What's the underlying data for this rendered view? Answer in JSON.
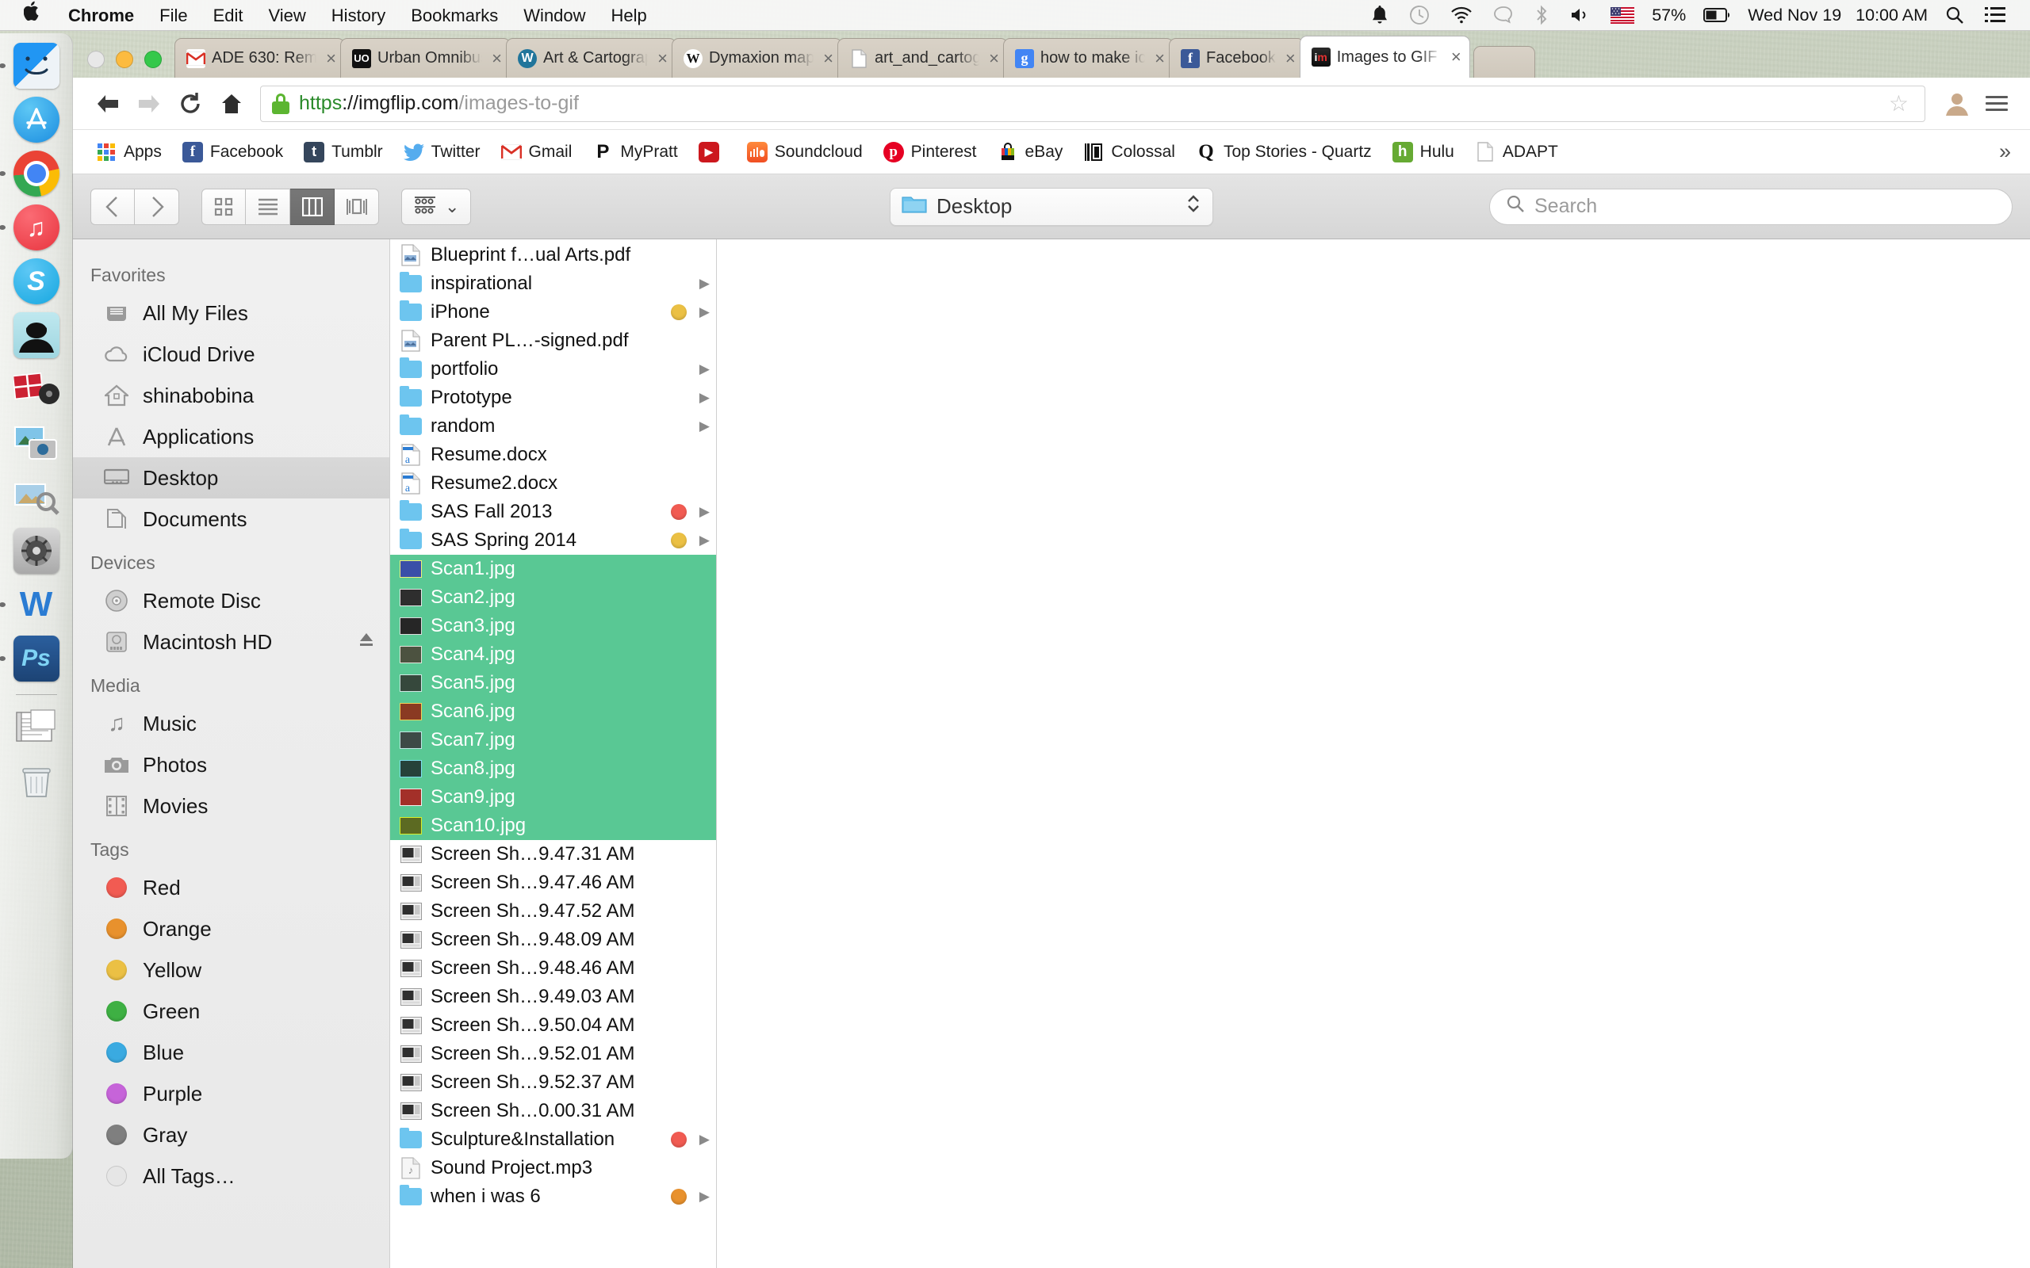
{
  "menubar": {
    "apple_icon": "apple-logo-icon",
    "app_name": "Chrome",
    "menus": [
      "File",
      "Edit",
      "View",
      "History",
      "Bookmarks",
      "Window",
      "Help"
    ],
    "status_icons": [
      "bell-icon",
      "time-machine-icon",
      "wifi-icon",
      "messages-icon",
      "bluetooth-icon",
      "volume-icon",
      "us-flag-icon"
    ],
    "battery_percent": "57%",
    "battery_icon": "battery-icon",
    "date": "Wed Nov 19",
    "time": "10:00 AM",
    "search_icon": "spotlight-search-icon",
    "notification_icon": "notification-center-icon"
  },
  "dock": {
    "items": [
      {
        "name": "finder",
        "label": "Finder",
        "running": true
      },
      {
        "name": "app-store",
        "label": "App Store",
        "running": false
      },
      {
        "name": "google-chrome",
        "label": "Google Chrome",
        "running": true
      },
      {
        "name": "itunes",
        "label": "iTunes",
        "running": true
      },
      {
        "name": "skype",
        "label": "Skype",
        "running": false
      },
      {
        "name": "adium",
        "label": "Adium",
        "running": false
      },
      {
        "name": "photo-booth",
        "label": "Photo Booth",
        "running": false
      },
      {
        "name": "preview",
        "label": "Preview",
        "running": false
      },
      {
        "name": "image-capture",
        "label": "Image Capture",
        "running": false
      },
      {
        "name": "system-preferences",
        "label": "System Preferences",
        "running": false
      },
      {
        "name": "microsoft-word",
        "label": "Microsoft Word",
        "running": true
      },
      {
        "name": "photoshop",
        "label": "Adobe Photoshop",
        "running": true,
        "badge": "Ps"
      },
      {
        "name": "documents-stack",
        "label": "Documents",
        "running": false
      },
      {
        "name": "trash",
        "label": "Trash",
        "running": false
      }
    ]
  },
  "browser": {
    "window_controls": [
      "close",
      "minimize",
      "maximize"
    ],
    "tabs": [
      {
        "title": "ADE 630: Remin",
        "favicon": "gmail-icon",
        "active": false,
        "close_label": "×"
      },
      {
        "title": "Urban Omnibus",
        "favicon": "urban-omnibus-icon",
        "active": false,
        "close_label": "×"
      },
      {
        "title": "Art & Cartograp",
        "favicon": "wordpress-icon",
        "active": false,
        "close_label": "×"
      },
      {
        "title": "Dymaxion map",
        "favicon": "wikipedia-icon",
        "active": false,
        "close_label": "×"
      },
      {
        "title": "art_and_cartogr",
        "favicon": "document-icon",
        "active": false,
        "close_label": "×"
      },
      {
        "title": "how to make ic",
        "favicon": "google-icon",
        "active": false,
        "close_label": "×"
      },
      {
        "title": "Facebook",
        "favicon": "facebook-icon",
        "active": false,
        "close_label": "×"
      },
      {
        "title": "Images to GIF G",
        "favicon": "imgflip-icon",
        "active": true,
        "close_label": "×"
      }
    ],
    "new_tab_label": "",
    "nav": {
      "back_icon": "back-arrow-icon",
      "forward_icon": "forward-arrow-icon",
      "reload_icon": "reload-icon",
      "home_icon": "home-icon",
      "bookmark_star_icon": "star-icon",
      "profile_icon": "profile-icon",
      "menu_icon": "hamburger-menu-icon"
    },
    "url": {
      "lock_icon": "secure-lock-icon",
      "scheme": "https",
      "separator": "://",
      "host": "imgflip.com",
      "path": "/images-to-gif",
      "full": "https://imgflip.com/images-to-gif"
    },
    "bookmarks": [
      {
        "label": "Apps",
        "icon": "apps-grid-icon"
      },
      {
        "label": "Facebook",
        "icon": "facebook-icon"
      },
      {
        "label": "Tumblr",
        "icon": "tumblr-icon"
      },
      {
        "label": "Twitter",
        "icon": "twitter-icon"
      },
      {
        "label": "Gmail",
        "icon": "gmail-icon"
      },
      {
        "label": "MyPratt",
        "icon": "mypratt-icon"
      },
      {
        "label": "",
        "icon": "youtube-icon"
      },
      {
        "label": "Soundcloud",
        "icon": "soundcloud-icon"
      },
      {
        "label": "Pinterest",
        "icon": "pinterest-icon"
      },
      {
        "label": "eBay",
        "icon": "ebay-icon"
      },
      {
        "label": "Colossal",
        "icon": "colossal-icon"
      },
      {
        "label": "Top Stories - Quartz",
        "icon": "quartz-icon"
      },
      {
        "label": "Hulu",
        "icon": "hulu-icon"
      },
      {
        "label": "ADAPT",
        "icon": "document-icon"
      }
    ],
    "bookmarks_overflow": "»"
  },
  "finder": {
    "toolbar": {
      "back_icon": "chevron-left-icon",
      "forward_icon": "chevron-right-icon",
      "views": [
        {
          "name": "icon-view",
          "active": false
        },
        {
          "name": "list-view",
          "active": false
        },
        {
          "name": "column-view",
          "active": true
        },
        {
          "name": "cover-flow-view",
          "active": false
        }
      ],
      "arrange_icon": "arrange-items-icon",
      "arrange_chevron": "⌄",
      "location": "Desktop",
      "location_icon": "folder-icon",
      "location_stepper_icon": "up-down-chevrons-icon",
      "search_placeholder": "Search",
      "search_icon": "search-icon"
    },
    "sidebar": {
      "sections": [
        {
          "header": "Favorites",
          "items": [
            {
              "label": "All My Files",
              "icon": "all-my-files-icon",
              "selected": false
            },
            {
              "label": "iCloud Drive",
              "icon": "cloud-icon",
              "selected": false
            },
            {
              "label": "shinabobina",
              "icon": "home-icon",
              "selected": false
            },
            {
              "label": "Applications",
              "icon": "applications-icon",
              "selected": false
            },
            {
              "label": "Desktop",
              "icon": "desktop-icon",
              "selected": true
            },
            {
              "label": "Documents",
              "icon": "documents-icon",
              "selected": false
            }
          ]
        },
        {
          "header": "Devices",
          "items": [
            {
              "label": "Remote Disc",
              "icon": "disc-icon",
              "selected": false
            },
            {
              "label": "Macintosh HD",
              "icon": "hard-drive-icon",
              "selected": false,
              "eject": true
            }
          ]
        },
        {
          "header": "Media",
          "items": [
            {
              "label": "Music",
              "icon": "music-note-icon",
              "selected": false
            },
            {
              "label": "Photos",
              "icon": "camera-icon",
              "selected": false
            },
            {
              "label": "Movies",
              "icon": "film-icon",
              "selected": false
            }
          ]
        },
        {
          "header": "Tags",
          "items": [
            {
              "label": "Red",
              "icon": "tag-dot-icon",
              "color": "#f15b52"
            },
            {
              "label": "Orange",
              "icon": "tag-dot-icon",
              "color": "#e8912d"
            },
            {
              "label": "Yellow",
              "icon": "tag-dot-icon",
              "color": "#ebc044"
            },
            {
              "label": "Green",
              "icon": "tag-dot-icon",
              "color": "#3eb043"
            },
            {
              "label": "Blue",
              "icon": "tag-dot-icon",
              "color": "#3aaae1"
            },
            {
              "label": "Purple",
              "icon": "tag-dot-icon",
              "color": "#c664d9"
            },
            {
              "label": "Gray",
              "icon": "tag-dot-icon",
              "color": "#7f7f7f"
            },
            {
              "label": "All Tags…",
              "icon": "all-tags-icon",
              "color": "#e0e0e0"
            }
          ]
        }
      ]
    },
    "files": [
      {
        "name": "Blueprint f…ual Arts.pdf",
        "type": "pdf",
        "selected": false,
        "tag": null,
        "chevron": false
      },
      {
        "name": "inspirational",
        "type": "folder",
        "selected": false,
        "tag": null,
        "chevron": true
      },
      {
        "name": "iPhone",
        "type": "folder",
        "selected": false,
        "tag": "#ebc044",
        "chevron": true
      },
      {
        "name": "Parent PL…-signed.pdf",
        "type": "pdf",
        "selected": false,
        "tag": null,
        "chevron": false
      },
      {
        "name": "portfolio",
        "type": "folder",
        "selected": false,
        "tag": null,
        "chevron": true
      },
      {
        "name": "Prototype",
        "type": "folder",
        "selected": false,
        "tag": null,
        "chevron": true
      },
      {
        "name": "random",
        "type": "folder",
        "selected": false,
        "tag": null,
        "chevron": true
      },
      {
        "name": "Resume.docx",
        "type": "docx",
        "selected": false,
        "tag": null,
        "chevron": false
      },
      {
        "name": "Resume2.docx",
        "type": "docx",
        "selected": false,
        "tag": null,
        "chevron": false
      },
      {
        "name": "SAS Fall 2013",
        "type": "folder",
        "selected": false,
        "tag": "#f15b52",
        "chevron": true
      },
      {
        "name": "SAS Spring 2014",
        "type": "folder",
        "selected": false,
        "tag": "#ebc044",
        "chevron": true
      },
      {
        "name": "Scan1.jpg",
        "type": "image",
        "selected": true,
        "tag": null,
        "chevron": false,
        "thumb": "#3a4fa8",
        "thumb_border": "#f0f07a"
      },
      {
        "name": "Scan2.jpg",
        "type": "image",
        "selected": true,
        "tag": null,
        "chevron": false,
        "thumb": "#2e2e2e",
        "thumb_border": "#e8e8e8"
      },
      {
        "name": "Scan3.jpg",
        "type": "image",
        "selected": true,
        "tag": null,
        "chevron": false,
        "thumb": "#262626",
        "thumb_border": "#dcdcdc"
      },
      {
        "name": "Scan4.jpg",
        "type": "image",
        "selected": true,
        "tag": null,
        "chevron": false,
        "thumb": "#4c5240",
        "thumb_border": "#e6e6dc"
      },
      {
        "name": "Scan5.jpg",
        "type": "image",
        "selected": true,
        "tag": null,
        "chevron": false,
        "thumb": "#36483c",
        "thumb_border": "#cfe6e2"
      },
      {
        "name": "Scan6.jpg",
        "type": "image",
        "selected": true,
        "tag": null,
        "chevron": false,
        "thumb": "#8a3a22",
        "thumb_border": "#f0d25a"
      },
      {
        "name": "Scan7.jpg",
        "type": "image",
        "selected": true,
        "tag": null,
        "chevron": false,
        "thumb": "#3d4a46",
        "thumb_border": "#bfe8e4"
      },
      {
        "name": "Scan8.jpg",
        "type": "image",
        "selected": true,
        "tag": null,
        "chevron": false,
        "thumb": "#26423a",
        "thumb_border": "#7fe0ef"
      },
      {
        "name": "Scan9.jpg",
        "type": "image",
        "selected": true,
        "tag": null,
        "chevron": false,
        "thumb": "#a33029",
        "thumb_border": "#f2f2f2"
      },
      {
        "name": "Scan10.jpg",
        "type": "image",
        "selected": true,
        "tag": null,
        "chevron": false,
        "thumb": "#5c6a22",
        "thumb_border": "#d9ef2a"
      },
      {
        "name": "Screen Sh…9.47.31 AM",
        "type": "screenshot",
        "selected": false,
        "tag": null,
        "chevron": false
      },
      {
        "name": "Screen Sh…9.47.46 AM",
        "type": "screenshot",
        "selected": false,
        "tag": null,
        "chevron": false
      },
      {
        "name": "Screen Sh…9.47.52 AM",
        "type": "screenshot",
        "selected": false,
        "tag": null,
        "chevron": false
      },
      {
        "name": "Screen Sh…9.48.09 AM",
        "type": "screenshot",
        "selected": false,
        "tag": null,
        "chevron": false
      },
      {
        "name": "Screen Sh…9.48.46 AM",
        "type": "screenshot",
        "selected": false,
        "tag": null,
        "chevron": false
      },
      {
        "name": "Screen Sh…9.49.03 AM",
        "type": "screenshot",
        "selected": false,
        "tag": null,
        "chevron": false
      },
      {
        "name": "Screen Sh…9.50.04 AM",
        "type": "screenshot",
        "selected": false,
        "tag": null,
        "chevron": false
      },
      {
        "name": "Screen Sh…9.52.01 AM",
        "type": "screenshot",
        "selected": false,
        "tag": null,
        "chevron": false
      },
      {
        "name": "Screen Sh…9.52.37 AM",
        "type": "screenshot",
        "selected": false,
        "tag": null,
        "chevron": false
      },
      {
        "name": "Screen Sh…0.00.31 AM",
        "type": "screenshot",
        "selected": false,
        "tag": null,
        "chevron": false
      },
      {
        "name": "Sculpture&Installation",
        "type": "folder",
        "selected": false,
        "tag": "#f15b52",
        "chevron": true
      },
      {
        "name": "Sound Project.mp3",
        "type": "audio",
        "selected": false,
        "tag": null,
        "chevron": false
      },
      {
        "name": "when i was 6",
        "type": "folder",
        "selected": false,
        "tag": "#e8912d",
        "chevron": true
      }
    ]
  },
  "colors": {
    "selection_green": "#59c894",
    "accent_blue": "#6dc5ef",
    "secure_green": "#2a8a2a"
  }
}
